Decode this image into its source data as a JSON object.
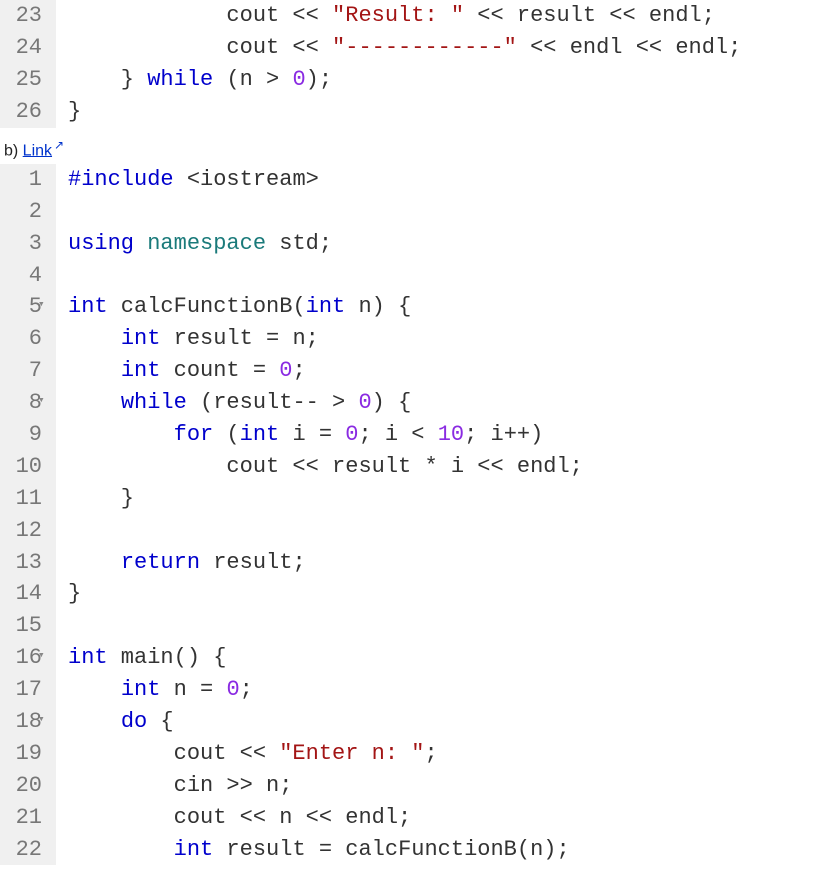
{
  "blockA": {
    "start": 23,
    "lines": [
      {
        "html": "            cout << <span class=\"str\">\"Result: \"</span> << result << endl;"
      },
      {
        "html": "            cout << <span class=\"str\">\"------------\"</span> << endl << endl;"
      },
      {
        "html": "    } <span class=\"kw\">while</span> (n > <span class=\"num\">0</span>);"
      },
      {
        "html": "}"
      }
    ]
  },
  "label": {
    "prefix": "b) ",
    "linkText": "Link"
  },
  "blockB": {
    "start": 1,
    "lines": [
      {
        "html": "<span class=\"kw\">#include</span> &lt;iostream&gt;"
      },
      {
        "html": ""
      },
      {
        "html": "<span class=\"kw\">using</span> <span class=\"ns\">namespace</span> std;"
      },
      {
        "html": ""
      },
      {
        "fold": true,
        "html": "<span class=\"kw\">int</span> calcFunctionB(<span class=\"kw\">int</span> n) {"
      },
      {
        "html": "    <span class=\"kw\">int</span> result = n;"
      },
      {
        "html": "    <span class=\"kw\">int</span> count = <span class=\"num\">0</span>;"
      },
      {
        "fold": true,
        "html": "    <span class=\"kw\">while</span> (result-- > <span class=\"num\">0</span>) {"
      },
      {
        "html": "        <span class=\"kw\">for</span> (<span class=\"kw\">int</span> i = <span class=\"num\">0</span>; i &lt; <span class=\"num\">10</span>; i++)"
      },
      {
        "html": "            cout << result * i << endl;"
      },
      {
        "html": "    }"
      },
      {
        "html": ""
      },
      {
        "html": "    <span class=\"kw\">return</span> result;"
      },
      {
        "html": "}"
      },
      {
        "html": ""
      },
      {
        "fold": true,
        "html": "<span class=\"kw\">int</span> main() {"
      },
      {
        "html": "    <span class=\"kw\">int</span> n = <span class=\"num\">0</span>;"
      },
      {
        "fold": true,
        "html": "    <span class=\"kw\">do</span> {"
      },
      {
        "html": "        cout << <span class=\"str\">\"Enter n: \"</span>;"
      },
      {
        "html": "        cin >> n;"
      },
      {
        "html": "        cout << n << endl;"
      },
      {
        "html": "        <span class=\"kw\">int</span> result = calcFunctionB(n);"
      }
    ]
  }
}
